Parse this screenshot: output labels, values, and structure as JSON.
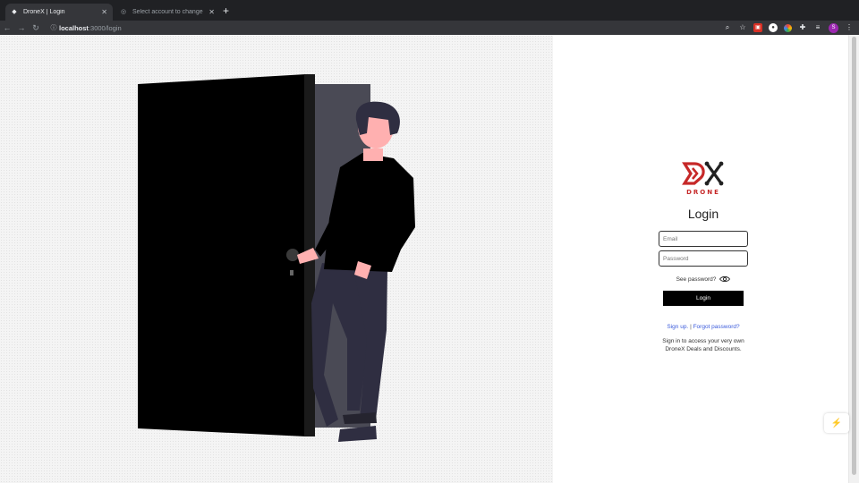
{
  "browser": {
    "tabs": [
      {
        "title": "DroneX | Login",
        "active": true
      },
      {
        "title": "Select account to change | Dja"
      }
    ],
    "new_tab": "+",
    "url_host": "localhost",
    "url_rest": ":3000/login"
  },
  "logo": {
    "monogram": "DX",
    "word": "DRONE",
    "colors": {
      "d": "#c62828",
      "x": "#222222"
    }
  },
  "login": {
    "heading": "Login",
    "email_placeholder": "Email",
    "password_placeholder": "Password",
    "see_password": "See password?",
    "button": "Login",
    "signup_link": "Sign up.",
    "separator": "|",
    "forgot_link": "Forgot password?",
    "info_line1": "Sign in to access your very own",
    "info_line2": "DroneX Deals and Discounts."
  },
  "dev_indicator": "⚡",
  "colors": {
    "accent": "#000000",
    "link": "#3b5bdb",
    "brand_red": "#c62828"
  }
}
